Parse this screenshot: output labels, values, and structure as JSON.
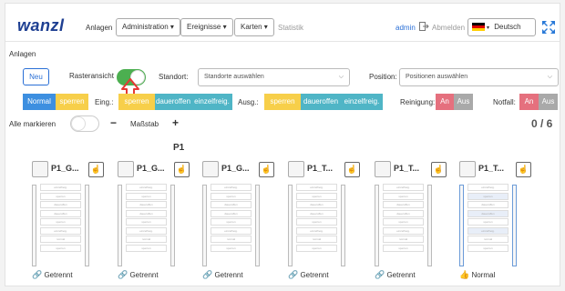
{
  "header": {
    "logo": "wanzl",
    "nav_anlagen": "Anlagen",
    "nav_administration": "Administration ▾",
    "nav_ereignisse": "Ereignisse ▾",
    "nav_karten": "Karten ▾",
    "nav_statistik": "Statistik",
    "user": "admin",
    "logout": "Abmelden",
    "language": "Deutsch"
  },
  "breadcrumb": "Anlagen",
  "toolbar": {
    "neu": "Neu",
    "rasteransicht": "Rasteransicht",
    "standort_label": "Standort:",
    "standort_value": "Standorte auswählen",
    "position_label": "Position:",
    "position_value": "Positionen auswählen"
  },
  "modes": {
    "normal": "Normal",
    "sperren": "sperren",
    "eing_label": "Eing.:",
    "eing_sperren": "sperren",
    "eing_daueroffen": "daueroffen",
    "eing_einzelfreig": "einzelfreig.",
    "ausg_label": "Ausg.:",
    "ausg_sperren": "sperren",
    "ausg_daueroffen": "daueroffen",
    "ausg_einzelfreig": "einzelfreig.",
    "reinigung_label": "Reinigung:",
    "reinigung_an": "An",
    "reinigung_aus": "Aus",
    "notfall_label": "Notfall:",
    "notfall_an": "An",
    "notfall_aus": "Aus"
  },
  "list": {
    "alle_markieren": "Alle markieren",
    "minus": "−",
    "massstab": "Maßstab",
    "plus": "+",
    "count": "0 / 6",
    "group": "P1"
  },
  "devices": [
    {
      "name": "P1_G...",
      "status": "Getrennt",
      "status_type": "disconnected"
    },
    {
      "name": "P1_G...",
      "status": "Getrennt",
      "status_type": "disconnected"
    },
    {
      "name": "P1_G...",
      "status": "Getrennt",
      "status_type": "disconnected"
    },
    {
      "name": "P1_T...",
      "status": "Getrennt",
      "status_type": "disconnected"
    },
    {
      "name": "P1_T...",
      "status": "Getrennt",
      "status_type": "disconnected"
    },
    {
      "name": "P1_T...",
      "status": "Normal",
      "status_type": "normal"
    }
  ],
  "cell_labels": [
    "einzelfreig.",
    "sperren",
    "daueroffen",
    "daueroffen",
    "sperren",
    "einzelfreig.",
    "normal",
    "sperren"
  ],
  "colors": {
    "brand": "#1e3f92",
    "blue": "#3d8fe0",
    "yellow": "#f7cf4a",
    "teal": "#4fb5c6",
    "red": "#e5707e",
    "gray": "#a9a9a9",
    "green": "#4caf50",
    "highlight_red": "#e53935"
  }
}
